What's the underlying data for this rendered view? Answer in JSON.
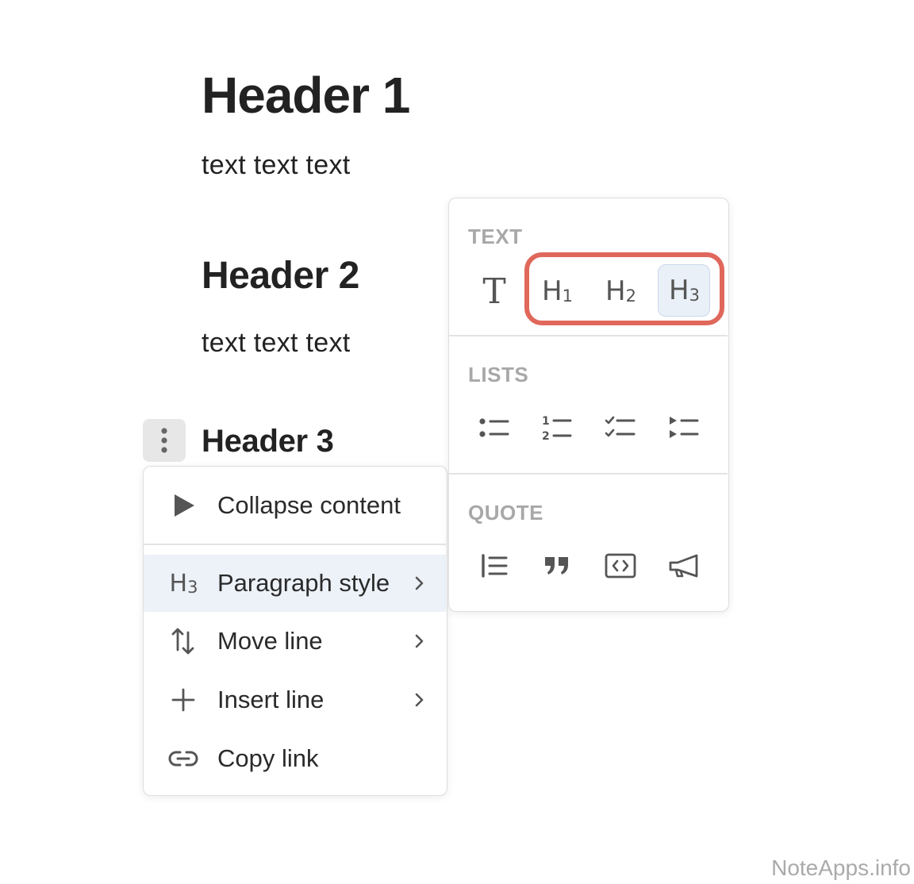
{
  "document": {
    "header1": "Header 1",
    "paragraph1": "text text text",
    "header2": "Header 2",
    "paragraph2": "text text text",
    "header3": "Header 3"
  },
  "block_handle": {
    "icon": "more-vertical-icon"
  },
  "context_menu": {
    "items": [
      {
        "label": "Collapse content",
        "icon": "play-triangle-icon",
        "has_submenu": false
      },
      {
        "label": "Paragraph style",
        "icon": "h3-icon",
        "icon_text": "H3",
        "has_submenu": true,
        "active": true
      },
      {
        "label": "Move line",
        "icon": "move-arrows-icon",
        "has_submenu": true
      },
      {
        "label": "Insert line",
        "icon": "plus-icon",
        "has_submenu": true
      },
      {
        "label": "Copy link",
        "icon": "link-icon",
        "has_submenu": false
      }
    ]
  },
  "style_popover": {
    "sections": [
      {
        "title": "TEXT",
        "buttons": [
          {
            "name": "plain-text",
            "icon": "text-t-icon",
            "glyph": "T"
          },
          {
            "name": "heading-1",
            "icon": "h1-icon",
            "glyph": "H",
            "sub": "1"
          },
          {
            "name": "heading-2",
            "icon": "h2-icon",
            "glyph": "H",
            "sub": "2"
          },
          {
            "name": "heading-3",
            "icon": "h3-icon",
            "glyph": "H",
            "sub": "3",
            "selected": true
          }
        ]
      },
      {
        "title": "LISTS",
        "buttons": [
          {
            "name": "bulleted-list",
            "icon": "bullet-list-icon"
          },
          {
            "name": "numbered-list",
            "icon": "numbered-list-icon"
          },
          {
            "name": "checklist",
            "icon": "checklist-icon"
          },
          {
            "name": "toggle-list",
            "icon": "toggle-list-icon"
          }
        ]
      },
      {
        "title": "QUOTE",
        "buttons": [
          {
            "name": "block-quote",
            "icon": "block-quote-icon"
          },
          {
            "name": "pull-quote",
            "icon": "quotation-marks-icon"
          },
          {
            "name": "code-block",
            "icon": "code-icon"
          },
          {
            "name": "callout",
            "icon": "megaphone-icon"
          }
        ]
      }
    ]
  },
  "annotation": {
    "highlight_color": "#e0675b",
    "highlighted": "heading buttons H1 H2 H3"
  },
  "colors": {
    "active_row": "#edf2f9",
    "selected_button": "#e9f0f8",
    "section_title": "#a8a8a8"
  },
  "watermark": "NoteApps.info"
}
